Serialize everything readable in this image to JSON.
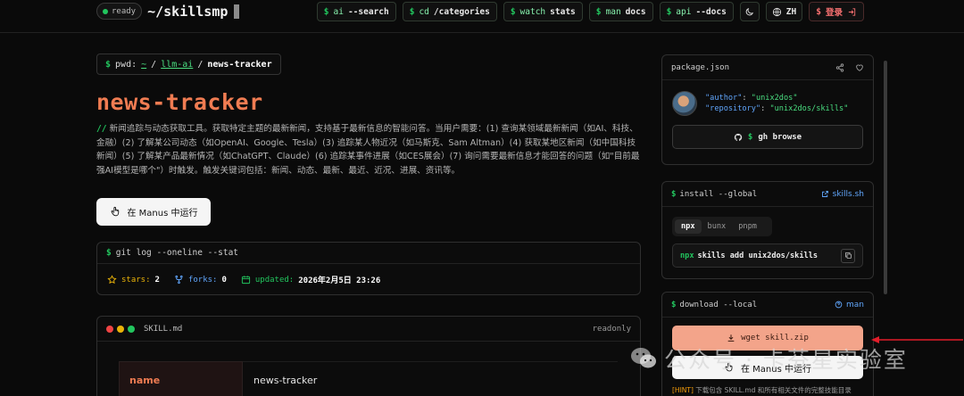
{
  "header": {
    "ready_badge": "ready",
    "logo_text": "~/skillsmp",
    "nav": [
      {
        "prefix": "$",
        "cmd": "ai",
        "arg": "--search"
      },
      {
        "prefix": "$",
        "cmd": "cd",
        "arg": "/categories"
      },
      {
        "prefix": "$",
        "cmd": "watch",
        "arg": "stats"
      },
      {
        "prefix": "$",
        "cmd": "man",
        "arg": "docs"
      },
      {
        "prefix": "$",
        "cmd": "api",
        "arg": "--docs"
      }
    ],
    "theme_icon": "moon-icon",
    "lang_label": "ZH",
    "login_prefix": "$",
    "login_label": "登录"
  },
  "breadcrumb": {
    "prefix": "$",
    "pwd_label": "pwd:",
    "home": "~",
    "sep1": "/",
    "category": "llm-ai",
    "sep2": "/",
    "current": "news-tracker"
  },
  "skill": {
    "title": "news-tracker",
    "desc_marker": "//",
    "description": "新闻追踪与动态获取工具。获取特定主题的最新新闻，支持基于最新信息的智能问答。当用户需要：(1) 查询某领域最新新闻（如AI、科技、金融）(2) 了解某公司动态（如OpenAI、Google、Tesla）(3) 追踪某人物近况（如马斯克、Sam Altman）(4) 获取某地区新闻（如中国科技新闻）(5) 了解某产品最新情况（如ChatGPT、Claude）(6) 追踪某事件进展（如CES展会）(7) 询问需要最新信息才能回答的问题（如\"目前最强AI模型是哪个\"）时触发。触发关键词包括：新闻、动态、最新、最近、近况、进展、资讯等。",
    "manus_button": "在 Manus 中运行"
  },
  "git_log": {
    "prefix": "$",
    "command": "git log --oneline --stat",
    "stars_label": "stars:",
    "stars": "2",
    "forks_label": "forks:",
    "forks": "0",
    "updated_label": "updated:",
    "updated": "2026年2月5日 23:26"
  },
  "skill_md": {
    "filename": "SKILL.md",
    "mode": "readonly",
    "frontmatter": [
      {
        "key": "name",
        "value": "news-tracker"
      }
    ]
  },
  "package_json": {
    "title": "package.json",
    "author_key": "\"author\"",
    "author_value": "\"unix2dos\"",
    "repo_key": "\"repository\"",
    "repo_value": "\"unix2dos/skills\"",
    "browse_prefix": "$",
    "browse_label": "gh browse"
  },
  "install": {
    "prefix": "$",
    "command": "install --global",
    "link_label": "skills.sh",
    "tabs": [
      "npx",
      "bunx",
      "pnpm"
    ],
    "active_tab": "npx",
    "cmd_bin": "npx",
    "cmd_rest": "skills add unix2dos/skills"
  },
  "download": {
    "prefix": "$",
    "command": "download --local",
    "man_label": "man",
    "wget_label": "wget skill.zip",
    "manus_button": "在 Manus 中运行",
    "hint_tag": "[HINT]",
    "hint_text": "下载包含 SKILL.md 和所有相关文件的完整技能目录"
  },
  "watermark": {
    "text": "公众号 · 卡芬星实验室"
  },
  "colors": {
    "accent_green": "#22c55e",
    "title_orange": "#f07c52",
    "link_blue": "#60a5fa",
    "wget_bg": "#f3a48a",
    "arrow_red": "#e11d2a"
  }
}
